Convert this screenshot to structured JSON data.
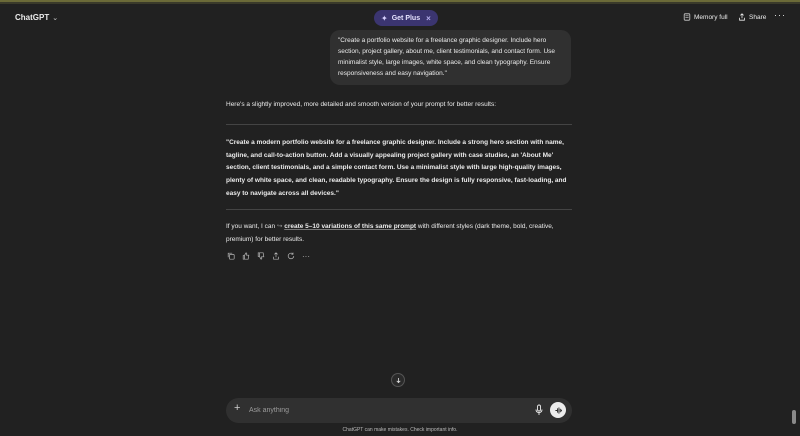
{
  "header": {
    "model_name": "ChatGPT",
    "get_plus_label": "Get Plus",
    "memory_label": "Memory full",
    "share_label": "Share"
  },
  "conversation": {
    "user_message": "\"Create a portfolio website for a freelance graphic designer. Include hero section, project gallery, about me, client testimonials, and contact form. Use minimalist style, large images, white space, and clean typography. Ensure responsiveness and easy navigation.\"",
    "assistant_intro": "Here's a slightly improved, more detailed and smooth version of your prompt for better results:",
    "assistant_quote": "\"Create a modern portfolio website for a freelance graphic designer. Include a strong hero section with name, tagline, and call-to-action button. Add a visually appealing project gallery with case studies, an 'About Me' section, client testimonials, and a simple contact form. Use a minimalist style with large high-quality images, plenty of white space, and clean, readable typography. Ensure the design is fully responsive, fast-loading, and easy to navigate across all devices.\"",
    "followup_prefix": "If you want, I can",
    "followup_arrow": "↪",
    "followup_link": "create 5–10 variations of this same prompt",
    "followup_suffix": "with different styles (dark theme, bold, creative, premium) for better results."
  },
  "composer": {
    "placeholder": "Ask anything"
  },
  "disclaimer": "ChatGPT can make mistakes. Check important info.",
  "icons": [
    "chevron-down-icon",
    "sparkle-icon",
    "close-icon",
    "memory-icon",
    "share-icon",
    "more-icon",
    "copy-icon",
    "thumbs-up-icon",
    "thumbs-down-icon",
    "share-icon",
    "regenerate-icon",
    "arrow-down-icon",
    "plus-icon",
    "mic-icon",
    "voice-mode-icon"
  ]
}
